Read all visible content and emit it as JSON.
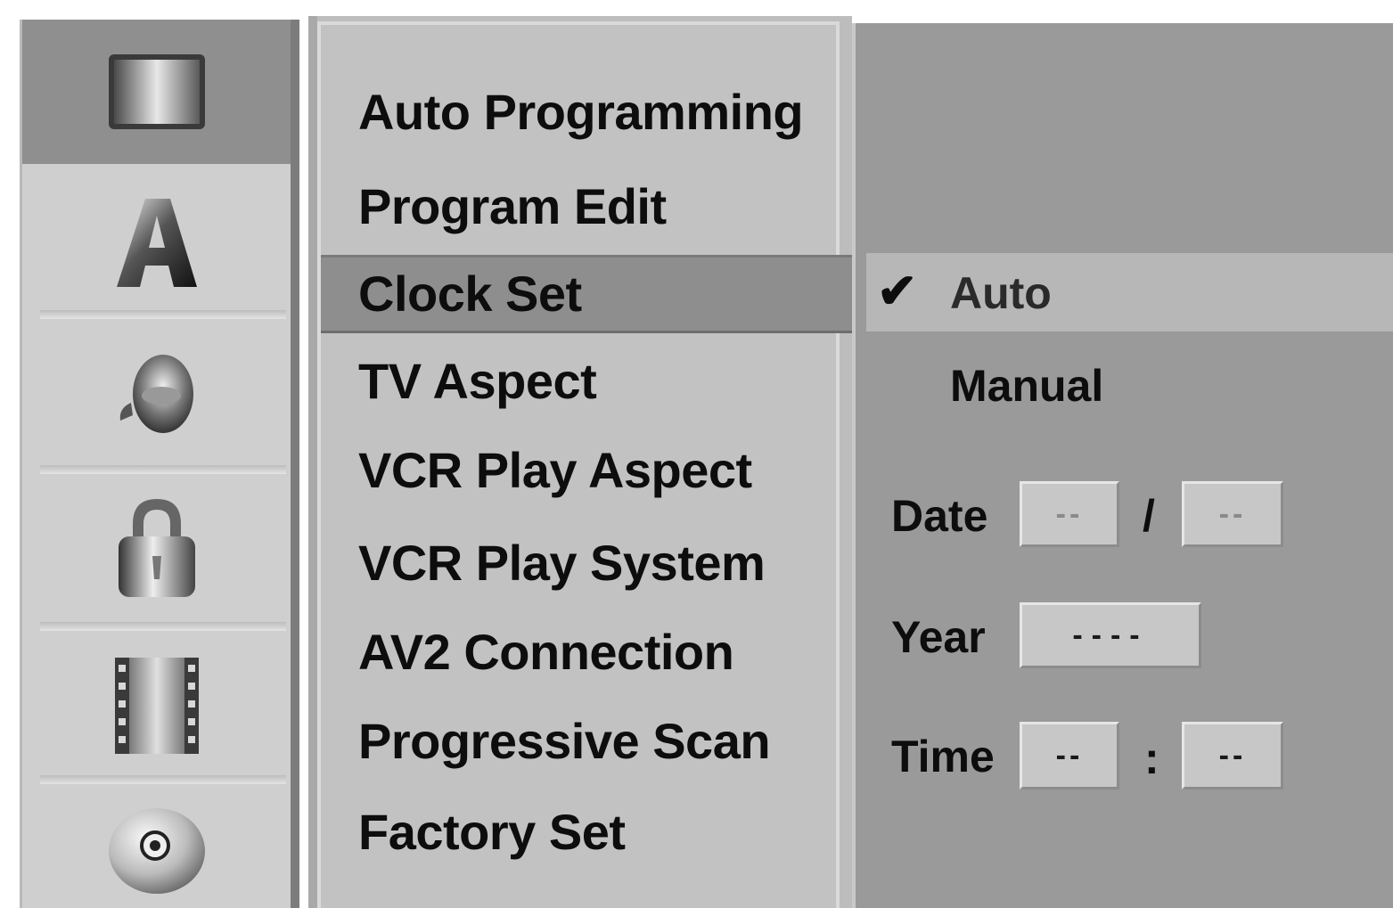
{
  "sidebar": {
    "icons": [
      {
        "name": "display-icon",
        "selected": true
      },
      {
        "name": "language-icon",
        "label": "A",
        "selected": false
      },
      {
        "name": "audio-icon",
        "selected": false
      },
      {
        "name": "lock-icon",
        "selected": false
      },
      {
        "name": "film-icon",
        "selected": false
      },
      {
        "name": "disc-icon",
        "selected": false
      }
    ]
  },
  "menu": {
    "items": [
      "Auto Programming",
      "Program Edit",
      "Clock Set",
      "TV Aspect",
      "VCR Play Aspect",
      "VCR Play System",
      "AV2 Connection",
      "Progressive Scan",
      "Factory Set"
    ],
    "selected": "Clock Set"
  },
  "submenu": {
    "options": [
      {
        "label": "Auto",
        "checked": true,
        "check_glyph": "✔"
      },
      {
        "label": "Manual",
        "checked": false
      }
    ],
    "date_label": "Date",
    "date_month": "--",
    "date_sep": "/",
    "date_day": "--",
    "year_label": "Year",
    "year_value": "----",
    "time_label": "Time",
    "time_hour": "--",
    "time_sep": ":",
    "time_min": "--"
  },
  "colors": {
    "selected_bg": "#8e8e8e",
    "panel_bg": "#c2c2c2",
    "submenu_bg": "#9a9a9a",
    "text": "#0d0d0d"
  }
}
